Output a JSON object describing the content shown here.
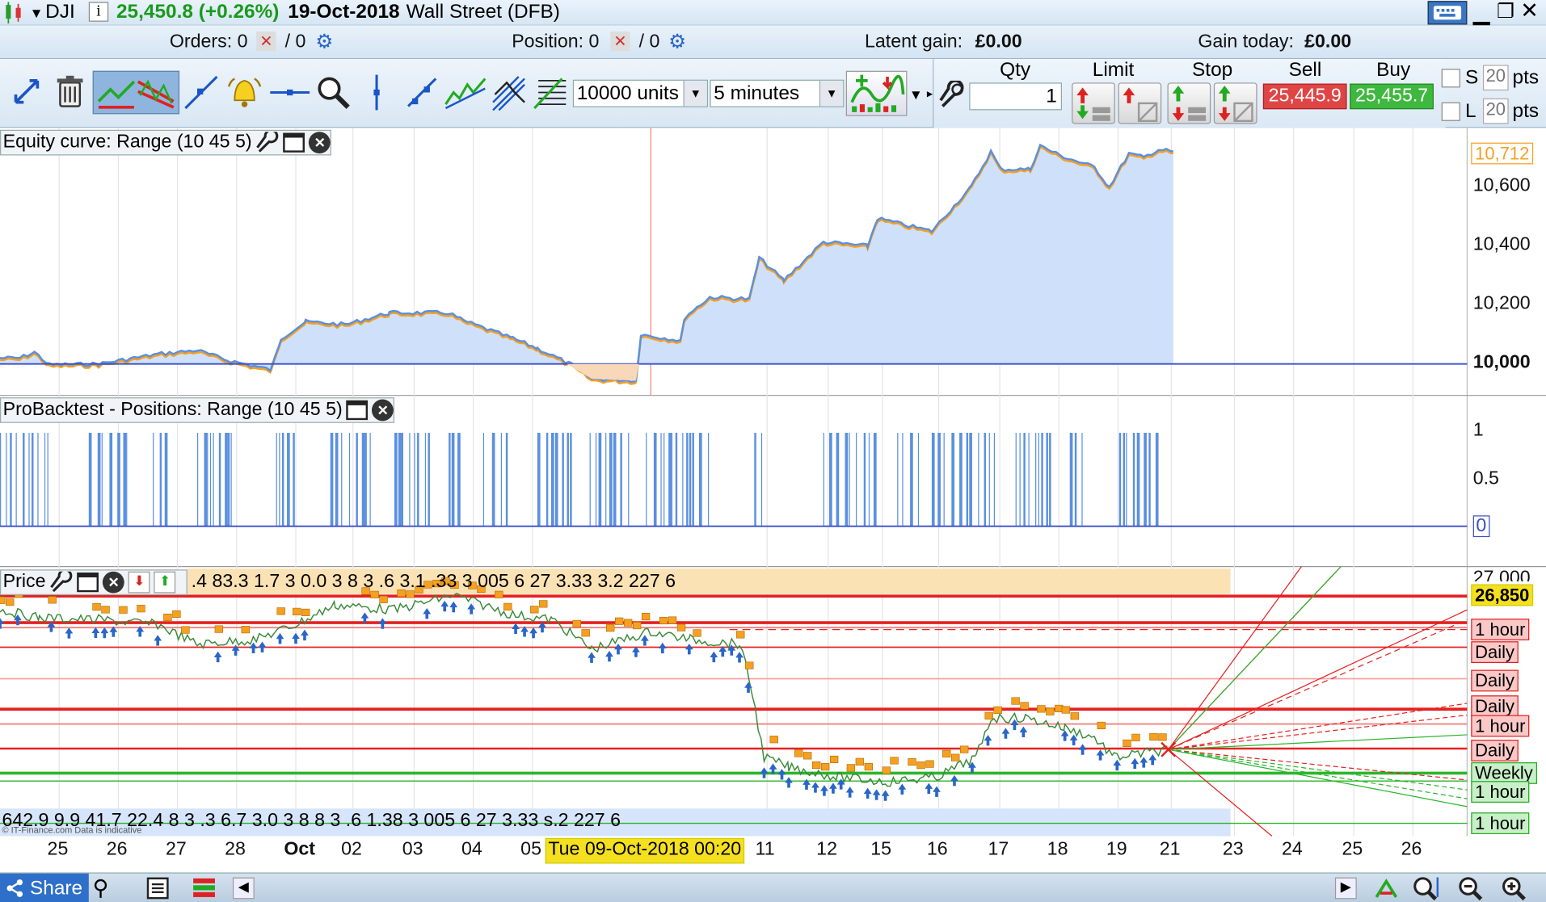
{
  "header": {
    "symbol": "DJI",
    "price": "25,450.8 (+0.26%)",
    "date": "19-Oct-2018",
    "market": "Wall Street (DFB)"
  },
  "info": {
    "orders_label": "Orders: 0",
    "orders_sep": "/ 0",
    "position_label": "Position: 0",
    "position_sep": "/ 0",
    "latent_label": "Latent gain: ",
    "latent_value": "£0.00",
    "gaintoday_label": "Gain today: ",
    "gaintoday_value": "£0.00"
  },
  "toolbar": {
    "units_select": "10000 units",
    "timeframe_select": "5 minutes",
    "qty_label": "Qty",
    "qty_value": "1",
    "limit_label": "Limit",
    "stop_label": "Stop",
    "sell_label": "Sell",
    "buy_label": "Buy",
    "sell_price": "25,445.9",
    "buy_price": "25,455.7",
    "s_label": "S",
    "l_label": "L",
    "s_pts": "20",
    "l_pts": "20",
    "pts_label": "pts"
  },
  "equity_panel": {
    "title": "Equity curve: Range (10 45 5)",
    "last_value": "10,712",
    "y_ticks": [
      "10,600",
      "10,400",
      "10,200",
      "10,000"
    ]
  },
  "positions_panel": {
    "title": "ProBacktest - Positions: Range (10 45 5)",
    "y_ticks": [
      "1",
      "0.5",
      "0"
    ]
  },
  "price_panel": {
    "title": "Price",
    "top_tick": "27,000",
    "tags": [
      "26,850",
      "1 hour",
      "Daily",
      "Daily",
      "Daily",
      "1 hour",
      "Daily",
      "Weekly",
      "1 hour",
      "1 hour"
    ],
    "top_strip_text": ".4 83.3 1.7 3 0.0 3 8 3 .6 3.1 .33 3 005 6 27 3.33 3.2 227 6",
    "bottom_strip_text": "642.9 9.9 41.7 22.4 8 3 .3 6.7 3.0 3 8 8 3 .6 1.38 3 005 6 27 3.33 s.2 227 6",
    "watermark": "© IT-Finance.com Data is indicative"
  },
  "x_axis": {
    "labels": [
      "25",
      "26",
      "27",
      "28",
      "Oct",
      "02",
      "03",
      "04",
      "05",
      "11",
      "12",
      "15",
      "16",
      "17",
      "18",
      "19",
      "21",
      "23",
      "24",
      "25",
      "26"
    ],
    "crosshair_label": "Tue 09-Oct-2018 00:20"
  },
  "bottom": {
    "share_label": "Share"
  },
  "colors": {
    "equity_line": "#5b8fe0",
    "equity_fill": "#cfe0fb",
    "drawdown_line": "#f5a020",
    "position_bar": "#5b8fe0",
    "sell_bg": "#e04545",
    "buy_bg": "#3fb83f",
    "resistance": "#e62020",
    "support": "#2bb52b"
  }
}
